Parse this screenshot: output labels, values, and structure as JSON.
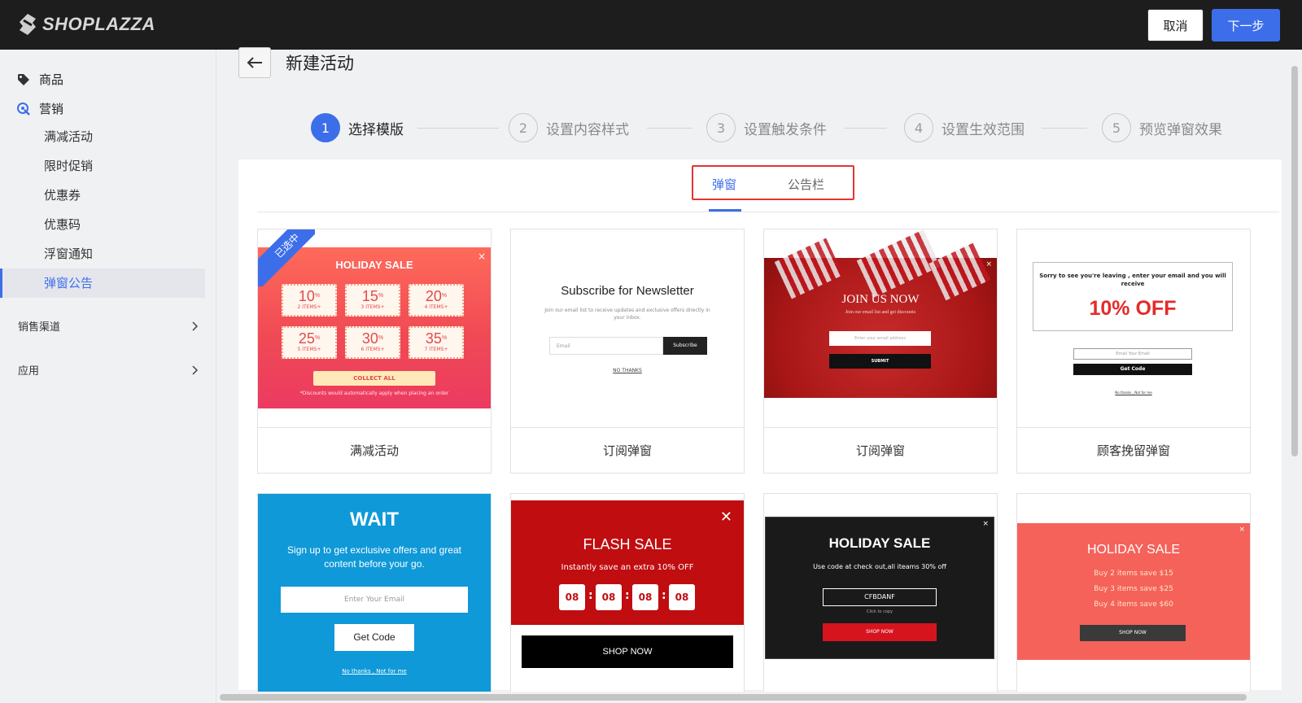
{
  "topbar": {
    "logo_text": "SHOPLAZZA",
    "cancel_label": "取消",
    "next_label": "下一步"
  },
  "sidebar": {
    "products": "商品",
    "marketing": "营销",
    "sub_items": [
      "满减活动",
      "限时促销",
      "优惠券",
      "优惠码",
      "浮窗通知",
      "弹窗公告"
    ],
    "active_sub": "弹窗公告",
    "sales_channels": "销售渠道",
    "apps": "应用"
  },
  "header": {
    "title": "新建活动"
  },
  "steps": [
    {
      "num": "1",
      "label": "选择模版",
      "active": true
    },
    {
      "num": "2",
      "label": "设置内容样式",
      "active": false
    },
    {
      "num": "3",
      "label": "设置触发条件",
      "active": false
    },
    {
      "num": "4",
      "label": "设置生效范围",
      "active": false
    },
    {
      "num": "5",
      "label": "预览弹窗效果",
      "active": false
    }
  ],
  "tabs": {
    "popup": "弹窗",
    "bar": "公告栏",
    "active": "弹窗"
  },
  "selected_badge": "已选中",
  "templates": [
    {
      "footer": "满减活动",
      "preview": {
        "title": "HOLIDAY SALE",
        "close": "×",
        "coupons": [
          {
            "pct": "10",
            "items": "2 ITEMS+"
          },
          {
            "pct": "15",
            "items": "3 ITEMS+"
          },
          {
            "pct": "20",
            "items": "4 ITEMS+"
          },
          {
            "pct": "25",
            "items": "5 ITEMS+"
          },
          {
            "pct": "30",
            "items": "6 ITEMS+"
          },
          {
            "pct": "35",
            "items": "7 ITEMS+"
          }
        ],
        "pct_sign": "%",
        "button": "COLLECT ALL",
        "note": "*Discounts would automatically apply when placing an order"
      }
    },
    {
      "footer": "订阅弹窗",
      "preview": {
        "title": "Subscribe for Newsletter",
        "subtitle": "Join our email list to receive updates and exclusive offers directly in your inbox.",
        "input": "Email",
        "button": "Subscribe",
        "no_thanks": "NO THANKS"
      }
    },
    {
      "footer": "订阅弹窗",
      "preview": {
        "title": "JOIN US NOW",
        "subtitle": "Join our email list and get discounts",
        "input": "Enter your email address",
        "button": "SUBMIT",
        "close": "×"
      }
    },
    {
      "footer": "顾客挽留弹窗",
      "preview": {
        "text": "Sorry to see you're leaving , enter your email and you will receive",
        "offer": "10% OFF",
        "input": "Email Your Email",
        "button": "Get Code",
        "no_thanks": "No thanks , Not for me"
      }
    },
    {
      "preview": {
        "title": "WAIT",
        "subtitle": "Sign up to get exclusive offers and great content before your go.",
        "input": "Enter Your Email",
        "button": "Get Code",
        "no_thanks": "No thanks , Not for me"
      }
    },
    {
      "preview": {
        "title": "FLASH SALE",
        "subtitle": "Instantly save an extra 10% OFF",
        "timer": [
          "08",
          "08",
          "08",
          "08"
        ],
        "colon": ":",
        "button": "SHOP NOW",
        "close": "✕"
      }
    },
    {
      "preview": {
        "title": "HOLIDAY SALE",
        "subtitle": "Use code at check out,all iteams 30% off",
        "code": "CFBDANF",
        "copy_hint": "Click to copy",
        "button": "SHOP NOW",
        "close": "×"
      }
    },
    {
      "preview": {
        "title": "HOLIDAY SALE",
        "lines": [
          "Buy 2 items save $15",
          "Buy 3 items save $25",
          "Buy 4 items save $60"
        ],
        "button": "SHOP NOW",
        "close": "×"
      }
    }
  ],
  "colors": {
    "accent": "#3d6eea",
    "topbar": "#1d1d1d",
    "highlight_border": "#e23535"
  }
}
